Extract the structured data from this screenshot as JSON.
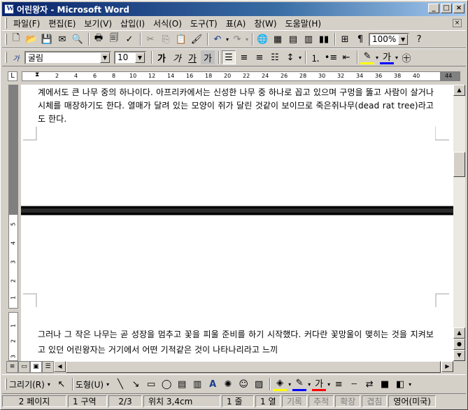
{
  "window": {
    "title": "어린왕자 - Microsoft Word"
  },
  "menubar": {
    "items": [
      "파일(F)",
      "편집(E)",
      "보기(V)",
      "삽입(I)",
      "서식(O)",
      "도구(T)",
      "표(A)",
      "창(W)",
      "도움말(H)"
    ]
  },
  "toolbar_standard": {
    "zoom": "100%"
  },
  "toolbar_format": {
    "style": "",
    "font": "굴림",
    "size": "10"
  },
  "ruler": {
    "numbers": [
      "2",
      "4",
      "6",
      "8",
      "10",
      "12",
      "14",
      "16",
      "18",
      "20",
      "22",
      "24",
      "26",
      "28",
      "30",
      "32",
      "34",
      "36",
      "38",
      "40",
      "44"
    ]
  },
  "vruler": {
    "numbers_top": [
      "5",
      "4",
      "3",
      "2",
      "1"
    ],
    "numbers_bottom": [
      "1",
      "2",
      "3"
    ]
  },
  "document": {
    "para1": "계에서도 큰 나무 중의 하나이다. 아프리카에서는 신성한 나무 중 하나로 꼽고 있으며 구멍을 뚫고 사람이 살거나 시체를 매장하기도 한다. 열매가 달려 있는 모양이 쥐가 달린 것같이 보이므로 죽은쥐나무(dead rat tree)라고도 한다.",
    "para2": "그러나 그 작은 나무는 곧 성장을 멈추고 꽃을 피울 준비를 하기 시작했다. 커다란 꽃망울이 맺히는 것을 지켜보고 있던 어린왕자는 거기에서 어떤 기적같은 것이 나타나리라고 느끼"
  },
  "drawbar": {
    "draw_label": "그리기(R)",
    "shapes_label": "도형(U)"
  },
  "statusbar": {
    "page": "2 페이지",
    "section": "1 구역",
    "pages": "2/3",
    "position": "위치 3,4cm",
    "line": "1 줄",
    "col": "1 열",
    "rec": "기록",
    "trk": "추적",
    "ext": "확장",
    "ovr": "겹침",
    "lang": "영어(미국)"
  },
  "colors": {
    "title_start": "#0a246a",
    "title_end": "#a6caf0",
    "chrome": "#d4d0c8",
    "highlight": "#ffff00",
    "font_color": "#ff0000",
    "line_color": "#0000ff"
  }
}
